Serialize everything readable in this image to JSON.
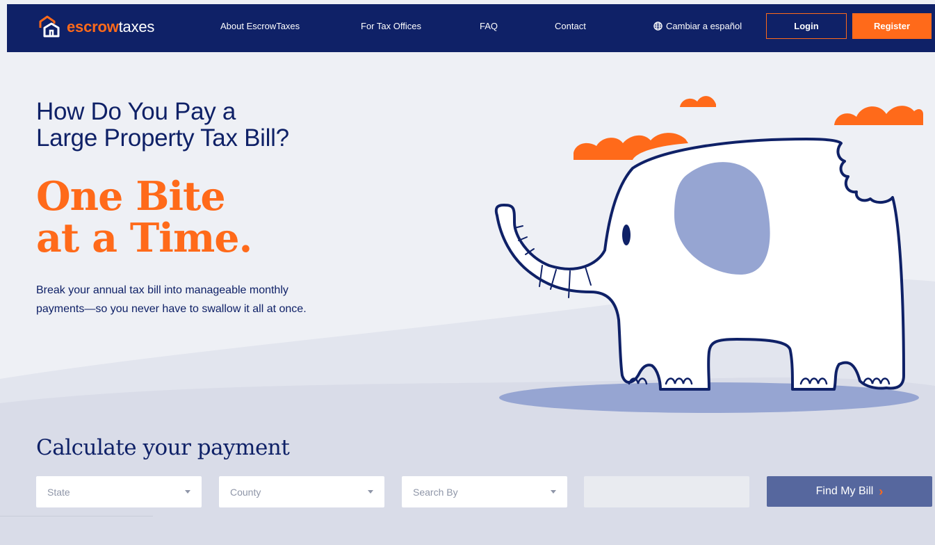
{
  "nav": {
    "logo_prefix": "escrow",
    "logo_suffix": "taxes",
    "links": [
      "About EscrowTaxes",
      "For Tax Offices",
      "FAQ",
      "Contact"
    ],
    "language_label": "Cambiar a español",
    "login_label": "Login",
    "register_label": "Register"
  },
  "hero": {
    "question_line1": "How Do You Pay a",
    "question_line2": "Large Property Tax Bill?",
    "tagline_line1": "One Bite",
    "tagline_line2": "at a Time.",
    "description_line1": "Break your annual tax bill into manageable monthly",
    "description_line2": "payments—so you never have to swallow it all at once."
  },
  "calculator": {
    "title": "Calculate your payment",
    "state_placeholder": "State",
    "county_placeholder": "County",
    "search_by_placeholder": "Search By",
    "search_value": "",
    "find_button_label": "Find My Bill"
  },
  "colors": {
    "navy": "#0f2167",
    "orange": "#ff6a1a",
    "slate_blue": "#56679e",
    "ear_blue": "#96a5d2",
    "background": "#eef0f5"
  },
  "icons": [
    "house-logo-icon",
    "globe-icon",
    "chevron-down-icon",
    "chevron-right-icon"
  ]
}
